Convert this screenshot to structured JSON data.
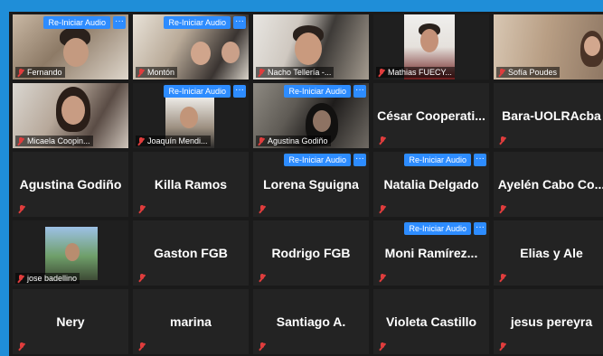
{
  "reaudio_label": "Re-Iniciar Audio",
  "more_label": "···",
  "tiles": [
    {
      "name": "Fernando",
      "short": "Fernando"
    },
    {
      "name": "Montón",
      "short": "Montón"
    },
    {
      "name": "Nacho Tellería",
      "short": "Nacho Tellería -..."
    },
    {
      "name": "Mathias FUECYT",
      "short": "Mathias FUECY..."
    },
    {
      "name": "Sofía Poudes",
      "short": "Sofía Poudes"
    },
    {
      "name": "Micaela Coopin",
      "short": "Micaela Coopin..."
    },
    {
      "name": "Joaquín Mendi",
      "short": "Joaquín Mendi..."
    },
    {
      "name": "Agustina Godiño",
      "short": "Agustina Godiño"
    },
    {
      "name": "César Cooperati...",
      "short": ""
    },
    {
      "name": "Bara-UOLRAcba",
      "short": ""
    },
    {
      "name": "Agustina Godiño",
      "short": ""
    },
    {
      "name": "Killa Ramos",
      "short": ""
    },
    {
      "name": "Lorena Sguigna",
      "short": ""
    },
    {
      "name": "Natalia Delgado",
      "short": ""
    },
    {
      "name": "Ayelén Cabo Co...",
      "short": ""
    },
    {
      "name": "jose badellino",
      "short": "jose badellino"
    },
    {
      "name": "Gaston FGB",
      "short": ""
    },
    {
      "name": "Rodrigo FGB",
      "short": ""
    },
    {
      "name": "Moni Ramírez...",
      "short": ""
    },
    {
      "name": "Elias y Ale",
      "short": ""
    },
    {
      "name": "Nery",
      "short": ""
    },
    {
      "name": "marina",
      "short": ""
    },
    {
      "name": "Santiago A.",
      "short": ""
    },
    {
      "name": "Violeta Castillo",
      "short": ""
    },
    {
      "name": "jesus pereyra",
      "short": ""
    }
  ],
  "colors": {
    "frame": "#1f8ed8",
    "tile": "#232323",
    "button": "#2d8cff",
    "muted": "#e03d3d"
  }
}
